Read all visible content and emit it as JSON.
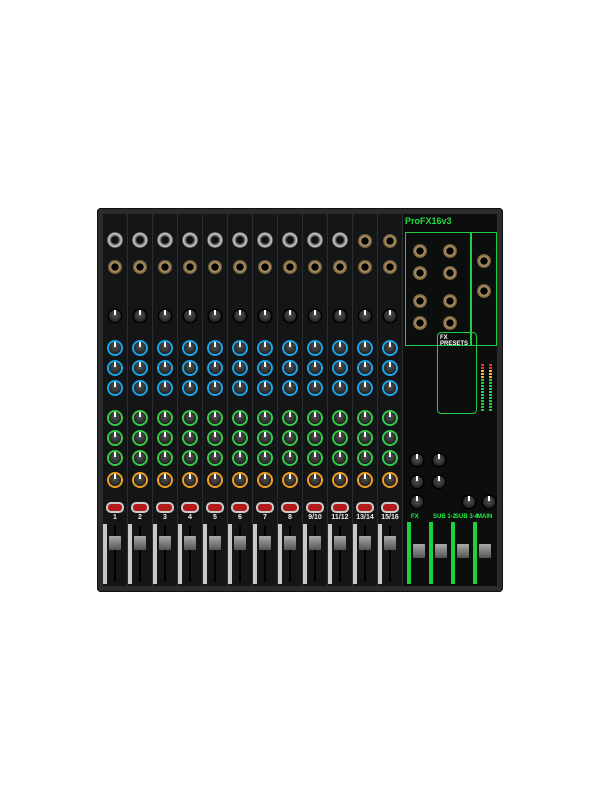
{
  "product": {
    "logo_text": "ProFX16v3",
    "fx_presets_title": "FX PRESETS",
    "channel_labels": [
      "1",
      "2",
      "3",
      "4",
      "5",
      "6",
      "7",
      "8",
      "9/10",
      "11/12",
      "13/14",
      "15/16"
    ],
    "master_labels": [
      "FX",
      "SUB 1-2",
      "SUB 3-4",
      "MAIN"
    ],
    "colors": {
      "accent_green": "#22cc44",
      "mute_red": "#b31a1a",
      "eq_blue": "#1aa6e8",
      "aux_green": "#33cc44",
      "pan_orange": "#f0a020",
      "panel": "#141516"
    }
  }
}
